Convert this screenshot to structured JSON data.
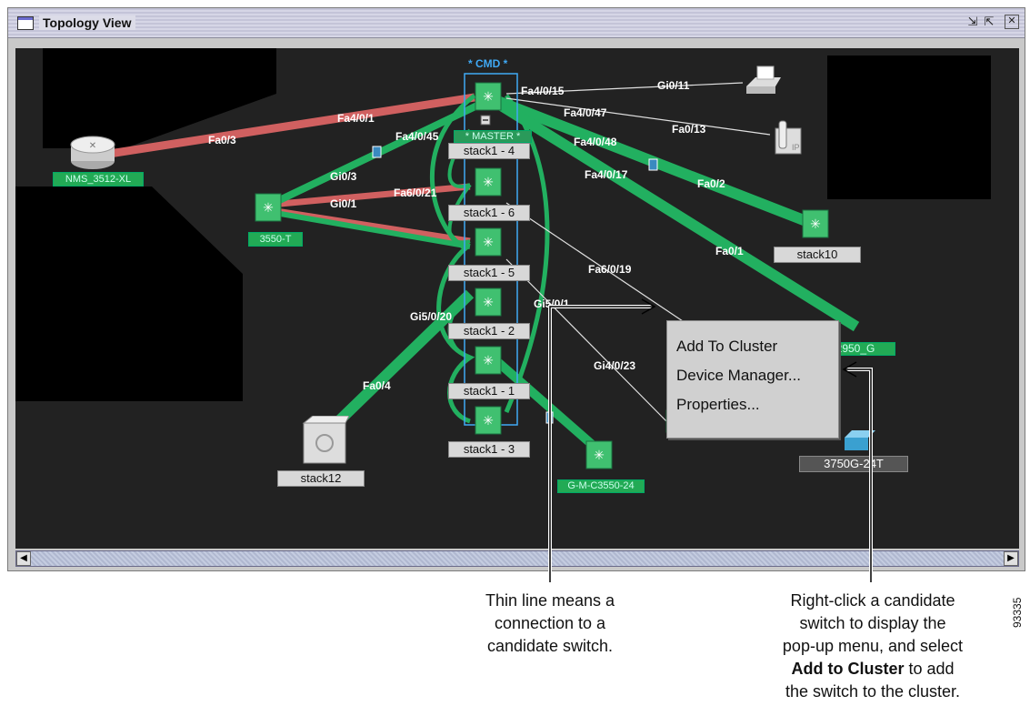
{
  "window": {
    "title": "Topology View",
    "buttons": [
      "restore",
      "maximize",
      "close"
    ]
  },
  "cmd_label": "* CMD *",
  "master_label": "* MASTER *",
  "devices": {
    "nms": "NMS_3512-XL",
    "sw3550t": "3550-T",
    "stack1_4": "stack1 - 4",
    "stack1_6": "stack1 - 6",
    "stack1_5": "stack1 - 5",
    "stack1_2": "stack1 - 2",
    "stack1_1": "stack1 - 1",
    "stack1_3": "stack1 - 3",
    "stack10": "stack10",
    "stack12": "stack12",
    "sw2950": "2950_G",
    "sw3750": "3750G-24T",
    "gm3550": "G-M-C3550-24"
  },
  "port_labels": {
    "fa4_0_15": "Fa4/0/15",
    "gi0_11": "Gi0/11",
    "fa4_0_47": "Fa4/0/47",
    "fa0_13": "Fa0/13",
    "fa4_0_48": "Fa4/0/48",
    "fa4_0_1": "Fa4/0/1",
    "fa0_3": "Fa0/3",
    "fa4_0_45": "Fa4/0/45",
    "gi0_3": "Gi0/3",
    "fa6_0_21": "Fa6/0/21",
    "gi0_1": "Gi0/1",
    "fa4_0_17": "Fa4/0/17",
    "fa0_2": "Fa0/2",
    "fa0_1": "Fa0/1",
    "fa6_0_19": "Fa6/0/19",
    "gi5_0_1": "Gi5/0/1",
    "gi5_0_20": "Gi5/0/20",
    "gi4_0_23": "Gi4/0/23",
    "fa0_4": "Fa0/4"
  },
  "context_menu": {
    "items": [
      "Add To Cluster",
      "Device Manager...",
      "Properties..."
    ]
  },
  "annotations": {
    "thin_line": [
      "Thin line means a",
      "connection to a",
      "candidate switch."
    ],
    "right_click_1": [
      "Right-click a candidate",
      "switch to display the",
      "pop-up menu, and select"
    ],
    "right_click_bold": "Add to Cluster",
    "right_click_2": " to add",
    "right_click_3": "the switch to the cluster."
  },
  "figure_number": "93335",
  "colors": {
    "canvas_bg": "#222222",
    "link_green": "#22b060",
    "link_red": "#d06060",
    "switch_green": "#40c070",
    "cmd_blue": "#3fa9f5"
  }
}
